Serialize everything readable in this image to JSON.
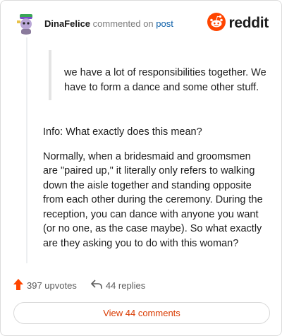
{
  "header": {
    "username": "DinaFelice",
    "verb": "commented on",
    "post_link": "post",
    "brand": "reddit"
  },
  "comment": {
    "quote": "we have a lot of responsibilities together. We have to form a dance and some other stuff.",
    "paragraphs": [
      "Info: What exactly does this mean?",
      "Normally, when a bridesmaid and groomsmen are \"paired up,\" it literally only refers to walking down the aisle together and standing opposite from each other during the ceremony. During the reception, you can dance with anyone you want (or no one, as the case maybe). So what exactly are they asking you to do with this woman?"
    ]
  },
  "stats": {
    "upvotes": "397 upvotes",
    "replies": "44 replies"
  },
  "view_button": "View 44 comments",
  "colors": {
    "upvote": "#ff4500",
    "brand": "#ff4500",
    "link": "#0a5ea8",
    "view_button_text": "#d93a00"
  },
  "icons": [
    "avatar",
    "reddit-snoo-icon",
    "upvote-icon",
    "reply-icon"
  ]
}
